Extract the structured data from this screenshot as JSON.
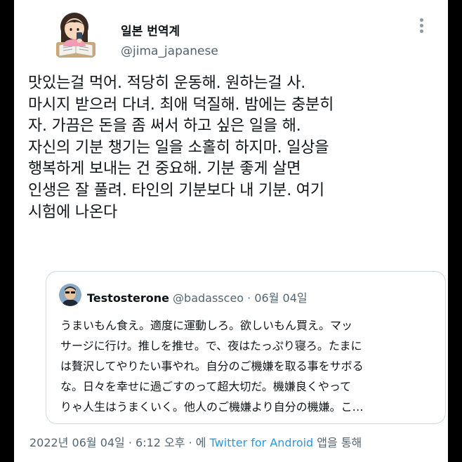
{
  "author": {
    "display_name": "일본 번역계",
    "handle": "@jima_japanese"
  },
  "tweet": {
    "lines": [
      "맛있는걸 먹어. 적당히 운동해. 원하는걸 사.",
      "마시지 받으러 다녀. 최애 덕질해. 밤에는 충분히",
      "자. 가끔은 돈을 좀 써서 하고 싶은 일을 해.",
      "자신의 기분 챙기는 일을 소홀히 하지마. 일상을",
      "행복하게 보내는 건 중요해. 기분 좋게 살면",
      "인생은 잘 풀려. 타인의 기분보다 내 기분. 여기",
      "시험에 나온다"
    ]
  },
  "quote": {
    "display_name": "Testosterone",
    "handle": "@badassceo",
    "separator": " · ",
    "date": "06월 04일",
    "lines": [
      "うまいもん食え。適度に運動しろ。欲しいもん買え。マッ",
      "サージに行け。推しを推せ。で、夜はたっぷり寝ろ。たまに",
      "は贅沢してやりたい事やれ。自分のご機嫌を取る事をサボる",
      "な。日々を幸せに過ごすのって超大切だ。機嫌良くやって",
      "りゃ人生はうまくいく。他人のご機嫌より自分の機嫌。こ…"
    ]
  },
  "footer": {
    "timestamp": "2022년 06월 04일 · 6:12 오후 · 에 ",
    "source": "Twitter for Android",
    "suffix": " 앱을 통해"
  },
  "icons": {
    "avatar": "avatar-illustration-icon",
    "more": "more-options-icon",
    "quote_avatar": "quote-avatar-icon"
  },
  "colors": {
    "background": "#000000",
    "card": "#ffffff",
    "text": "#0f1419",
    "secondary": "#536471",
    "link": "#1d9bf0",
    "border": "#cfd9de"
  }
}
